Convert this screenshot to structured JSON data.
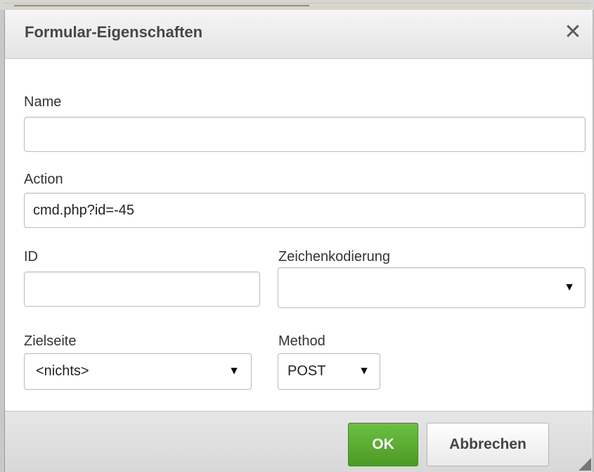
{
  "dialog": {
    "title": "Formular-Eigenschaften",
    "close_icon": "close-icon"
  },
  "form": {
    "name": {
      "label": "Name",
      "value": ""
    },
    "action": {
      "label": "Action",
      "value": "cmd.php?id=-45"
    },
    "id": {
      "label": "ID",
      "value": ""
    },
    "encoding": {
      "label": "Zeichenkodierung",
      "value": ""
    },
    "target": {
      "label": "Zielseite",
      "value": "<nichts>"
    },
    "method": {
      "label": "Method",
      "value": "POST"
    }
  },
  "footer": {
    "ok_label": "OK",
    "cancel_label": "Abbrechen",
    "ok_color": "#5bab30"
  }
}
